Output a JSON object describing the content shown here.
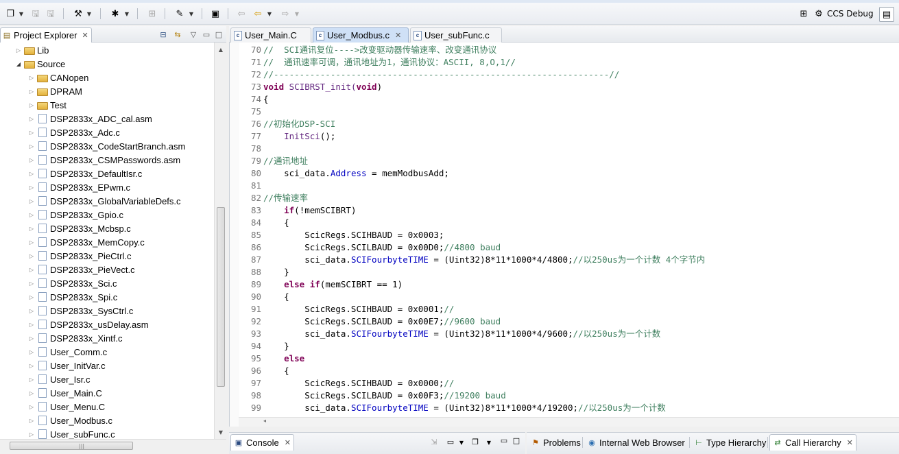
{
  "perspective": {
    "label": "CCS Debug"
  },
  "project_explorer": {
    "title": "Project Explorer",
    "items": [
      {
        "label": "Lib",
        "type": "folder",
        "level": 1,
        "expanded": false
      },
      {
        "label": "Source",
        "type": "folder",
        "level": 1,
        "expanded": true
      },
      {
        "label": "CANopen",
        "type": "folder",
        "level": 2,
        "expanded": false
      },
      {
        "label": "DPRAM",
        "type": "folder",
        "level": 2,
        "expanded": false
      },
      {
        "label": "Test",
        "type": "folder",
        "level": 2,
        "expanded": false
      },
      {
        "label": "DSP2833x_ADC_cal.asm",
        "type": "file",
        "level": 2
      },
      {
        "label": "DSP2833x_Adc.c",
        "type": "file",
        "level": 2
      },
      {
        "label": "DSP2833x_CodeStartBranch.asm",
        "type": "file",
        "level": 2
      },
      {
        "label": "DSP2833x_CSMPasswords.asm",
        "type": "file",
        "level": 2
      },
      {
        "label": "DSP2833x_DefaultIsr.c",
        "type": "file",
        "level": 2
      },
      {
        "label": "DSP2833x_EPwm.c",
        "type": "file",
        "level": 2
      },
      {
        "label": "DSP2833x_GlobalVariableDefs.c",
        "type": "file",
        "level": 2
      },
      {
        "label": "DSP2833x_Gpio.c",
        "type": "file",
        "level": 2
      },
      {
        "label": "DSP2833x_Mcbsp.c",
        "type": "file",
        "level": 2
      },
      {
        "label": "DSP2833x_MemCopy.c",
        "type": "file",
        "level": 2
      },
      {
        "label": "DSP2833x_PieCtrl.c",
        "type": "file",
        "level": 2
      },
      {
        "label": "DSP2833x_PieVect.c",
        "type": "file",
        "level": 2
      },
      {
        "label": "DSP2833x_Sci.c",
        "type": "file",
        "level": 2
      },
      {
        "label": "DSP2833x_Spi.c",
        "type": "file",
        "level": 2
      },
      {
        "label": "DSP2833x_SysCtrl.c",
        "type": "file",
        "level": 2
      },
      {
        "label": "DSP2833x_usDelay.asm",
        "type": "file",
        "level": 2
      },
      {
        "label": "DSP2833x_Xintf.c",
        "type": "file",
        "level": 2
      },
      {
        "label": "User_Comm.c",
        "type": "file",
        "level": 2
      },
      {
        "label": "User_InitVar.c",
        "type": "file",
        "level": 2
      },
      {
        "label": "User_Isr.c",
        "type": "file",
        "level": 2
      },
      {
        "label": "User_Main.C",
        "type": "file",
        "level": 2
      },
      {
        "label": "User_Menu.C",
        "type": "file",
        "level": 2
      },
      {
        "label": "User_Modbus.c",
        "type": "file",
        "level": 2
      },
      {
        "label": "User_subFunc.c",
        "type": "file",
        "level": 2
      }
    ]
  },
  "editor": {
    "tabs": [
      {
        "label": "User_Main.C",
        "active": false
      },
      {
        "label": "User_Modbus.c",
        "active": true
      },
      {
        "label": "User_subFunc.c",
        "active": false
      }
    ],
    "lines": [
      {
        "n": "70",
        "parts": [
          {
            "t": "//  SCI通讯复位---->改变驱动器传输速率、改变通讯协议",
            "c": "cm"
          }
        ]
      },
      {
        "n": "71",
        "parts": [
          {
            "t": "//  通讯速率可调，通讯地址为1，通讯协议：ASCII, 8,O,1//",
            "c": "cm"
          }
        ]
      },
      {
        "n": "72",
        "parts": [
          {
            "t": "//-----------------------------------------------------------------//",
            "c": "cm"
          }
        ]
      },
      {
        "n": "73",
        "parts": [
          {
            "t": "void",
            "c": "kw"
          },
          {
            "t": " SCIBRST_init(",
            "c": "fn"
          },
          {
            "t": "void",
            "c": "kw"
          },
          {
            "t": ")",
            "c": ""
          }
        ]
      },
      {
        "n": "74",
        "parts": [
          {
            "t": "{",
            "c": ""
          }
        ]
      },
      {
        "n": "75",
        "parts": []
      },
      {
        "n": "76",
        "parts": [
          {
            "t": "//初始化DSP-SCI",
            "c": "cm"
          }
        ]
      },
      {
        "n": "77",
        "parts": [
          {
            "t": "    ",
            "c": ""
          },
          {
            "t": "InitSci",
            "c": "fn"
          },
          {
            "t": "();",
            "c": ""
          }
        ]
      },
      {
        "n": "78",
        "parts": []
      },
      {
        "n": "79",
        "parts": [
          {
            "t": "//通讯地址",
            "c": "cm"
          }
        ]
      },
      {
        "n": "80",
        "parts": [
          {
            "t": "    sci_data.",
            "c": ""
          },
          {
            "t": "Address",
            "c": "fld"
          },
          {
            "t": " = memModbusAdd;",
            "c": ""
          }
        ]
      },
      {
        "n": "81",
        "parts": []
      },
      {
        "n": "82",
        "parts": [
          {
            "t": "//传输速率",
            "c": "cm"
          }
        ]
      },
      {
        "n": "83",
        "parts": [
          {
            "t": "    ",
            "c": ""
          },
          {
            "t": "if",
            "c": "kw"
          },
          {
            "t": "(!memSCIBRT)",
            "c": ""
          }
        ]
      },
      {
        "n": "84",
        "parts": [
          {
            "t": "    {",
            "c": ""
          }
        ]
      },
      {
        "n": "85",
        "parts": [
          {
            "t": "        ScicRegs.SCIHBAUD = 0x0003;",
            "c": ""
          }
        ]
      },
      {
        "n": "86",
        "parts": [
          {
            "t": "        ScicRegs.SCILBAUD = 0x00D0;",
            "c": ""
          },
          {
            "t": "//4800 baud",
            "c": "cm"
          }
        ]
      },
      {
        "n": "87",
        "parts": [
          {
            "t": "        sci_data.",
            "c": ""
          },
          {
            "t": "SCIFourbyteTIME",
            "c": "fld"
          },
          {
            "t": " = (Uint32)8*11*1000*4/4800;",
            "c": ""
          },
          {
            "t": "//以250us为一个计数 4个字节内",
            "c": "cm"
          }
        ]
      },
      {
        "n": "88",
        "parts": [
          {
            "t": "    }",
            "c": ""
          }
        ]
      },
      {
        "n": "89",
        "parts": [
          {
            "t": "    ",
            "c": ""
          },
          {
            "t": "else if",
            "c": "kw"
          },
          {
            "t": "(memSCIBRT == 1)",
            "c": ""
          }
        ]
      },
      {
        "n": "90",
        "parts": [
          {
            "t": "    {",
            "c": ""
          }
        ]
      },
      {
        "n": "91",
        "parts": [
          {
            "t": "        ScicRegs.SCIHBAUD = 0x0001;",
            "c": ""
          },
          {
            "t": "//",
            "c": "cm"
          }
        ]
      },
      {
        "n": "92",
        "parts": [
          {
            "t": "        ScicRegs.SCILBAUD = 0x00E7;",
            "c": ""
          },
          {
            "t": "//9600 baud",
            "c": "cm"
          }
        ]
      },
      {
        "n": "93",
        "parts": [
          {
            "t": "        sci_data.",
            "c": ""
          },
          {
            "t": "SCIFourbyteTIME",
            "c": "fld"
          },
          {
            "t": " = (Uint32)8*11*1000*4/9600;",
            "c": ""
          },
          {
            "t": "//以250us为一个计数",
            "c": "cm"
          }
        ]
      },
      {
        "n": "94",
        "parts": [
          {
            "t": "    }",
            "c": ""
          }
        ]
      },
      {
        "n": "95",
        "parts": [
          {
            "t": "    ",
            "c": ""
          },
          {
            "t": "else",
            "c": "kw"
          }
        ]
      },
      {
        "n": "96",
        "parts": [
          {
            "t": "    {",
            "c": ""
          }
        ]
      },
      {
        "n": "97",
        "parts": [
          {
            "t": "        ScicRegs.SCIHBAUD = 0x0000;",
            "c": ""
          },
          {
            "t": "//",
            "c": "cm"
          }
        ]
      },
      {
        "n": "98",
        "parts": [
          {
            "t": "        ScicRegs.SCILBAUD = 0x00F3;",
            "c": ""
          },
          {
            "t": "//19200 baud",
            "c": "cm"
          }
        ]
      },
      {
        "n": "99",
        "parts": [
          {
            "t": "        sci_data.",
            "c": ""
          },
          {
            "t": "SCIFourbyteTIME",
            "c": "fld"
          },
          {
            "t": " = (Uint32)8*11*1000*4/19200;",
            "c": ""
          },
          {
            "t": "//以250us为一个计数",
            "c": "cm"
          }
        ]
      }
    ]
  },
  "bottom_left": {
    "console_label": "Console"
  },
  "bottom_right": {
    "tabs": [
      {
        "label": "Problems",
        "icon": "problems-icon",
        "active": false
      },
      {
        "label": "Internal Web Browser",
        "icon": "globe-icon",
        "active": false
      },
      {
        "label": "Type Hierarchy",
        "icon": "type-hierarchy-icon",
        "active": false
      },
      {
        "label": "Call Hierarchy",
        "icon": "call-hierarchy-icon",
        "active": true
      }
    ]
  },
  "colors": {
    "comment": "#3f7f5f",
    "keyword": "#7f0055",
    "field": "#0000c0",
    "function": "#642880",
    "line_number": "#787878",
    "active_tab": "#cfe0f6"
  }
}
